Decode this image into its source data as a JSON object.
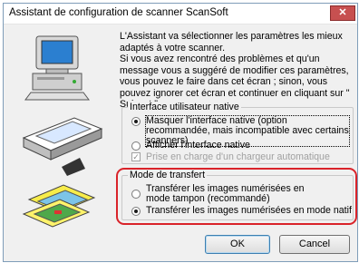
{
  "window": {
    "title": "Assistant de configuration de scanner ScanSoft",
    "close_glyph": "✕"
  },
  "description": {
    "p1": "L'Assistant va sélectionner les paramètres les mieux adaptés à votre scanner.",
    "p2": "Si vous avez rencontré des problèmes et qu'un message vous a suggéré de modifier ces paramètres, vous pouvez le faire dans cet écran ; sinon, vous pouvez ignorer cet écran et continuer en cliquant sur \" Suivant \"."
  },
  "ui_group": {
    "title": "Interface utilisateur native",
    "opt_hide": "Masquer l'interface native (option recommandée, mais incompatible avec certains scanners)",
    "opt_show": "Afficher l'interface native",
    "opt_feeder": "Prise en charge d'un chargeur automatique"
  },
  "transfer_group": {
    "title": "Mode de transfert",
    "opt_buffered": "Transférer les images numérisées en mode tampon (recommandé)",
    "opt_native": "Transférer les images numérisées en mode natif"
  },
  "buttons": {
    "ok": "OK",
    "cancel": "Cancel"
  },
  "icons": {
    "computer": "computer-icon",
    "scanner": "scanner-icon",
    "documents": "documents-icon"
  },
  "colors": {
    "highlight": "#d9232a",
    "close": "#c75050"
  }
}
